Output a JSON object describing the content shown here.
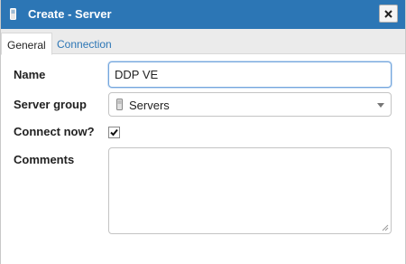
{
  "dialog": {
    "title": "Create - Server",
    "title_icon": "server-icon",
    "close_icon": "close-icon"
  },
  "tabs": [
    {
      "label": "General",
      "active": true
    },
    {
      "label": "Connection",
      "active": false
    }
  ],
  "form": {
    "name": {
      "label": "Name",
      "value": "DDP VE"
    },
    "server_group": {
      "label": "Server group",
      "value": "Servers",
      "icon": "server-group-icon"
    },
    "connect_now": {
      "label": "Connect now?",
      "checked": true
    },
    "comments": {
      "label": "Comments",
      "value": ""
    }
  },
  "colors": {
    "titlebar": "#2c76b5",
    "tab_link": "#2c76b5"
  }
}
